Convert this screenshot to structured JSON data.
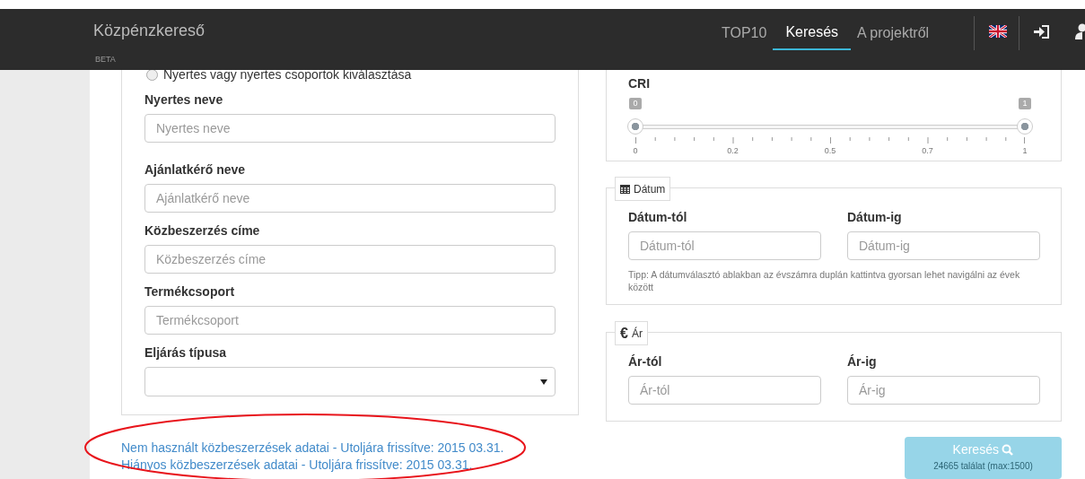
{
  "navbar": {
    "brand": "Közpénzkereső",
    "badge": "BETA",
    "items": [
      {
        "label": "TOP10",
        "selected": false
      },
      {
        "label": "Keresés",
        "selected": true
      },
      {
        "label": "A projektről",
        "selected": false
      }
    ]
  },
  "winner_form": {
    "radios": [
      {
        "label": "Nyertes vagy nyertes csoportok kiválasztása",
        "selected": false
      }
    ],
    "fields": [
      {
        "kind": "text",
        "label": "Nyertes neve",
        "placeholder": "Nyertes neve"
      },
      {
        "kind": "text",
        "label": "Ajánlatkérő neve",
        "placeholder": "Ajánlatkérő neve"
      },
      {
        "kind": "text",
        "label": "Közbeszerzés címe",
        "placeholder": "Közbeszerzés címe"
      },
      {
        "kind": "text",
        "label": "Termékcsoport",
        "placeholder": "Termékcsoport"
      },
      {
        "kind": "select",
        "label": "Eljárás típusa"
      }
    ]
  },
  "links": [
    "Nem használt közbeszerzések adatai - Utoljára frissítve: 2015 03.31.",
    "Hiányos közbeszerzések adatai - Utoljára frissítve: 2015 03.31."
  ],
  "cri": {
    "slider": {
      "label": "CRI",
      "handles": [
        {
          "badge": "0",
          "level": 0
        },
        {
          "badge": "1",
          "level": 1
        }
      ],
      "tick_labels": [
        "0",
        "0.2",
        "0.5",
        "0.7",
        "1"
      ]
    }
  },
  "date": {
    "legend": "Dátum",
    "fields": [
      {
        "label": "Dátum-tól",
        "placeholder": "Dátum-tól"
      },
      {
        "label": "Dátum-ig",
        "placeholder": "Dátum-ig"
      }
    ],
    "tip": "Tipp: A dátumválasztó ablakban az évszámra duplán kattintva gyorsan lehet navigálni az évek között"
  },
  "price": {
    "legend": "Ár",
    "icon": "€",
    "fields": [
      {
        "label": "Ár-tól",
        "placeholder": "Ár-tól"
      },
      {
        "label": "Ár-ig",
        "placeholder": "Ár-ig"
      }
    ]
  },
  "search_button": {
    "label": "Keresés",
    "subtext": "24665 találat (max:1500)",
    "disabled": true
  }
}
